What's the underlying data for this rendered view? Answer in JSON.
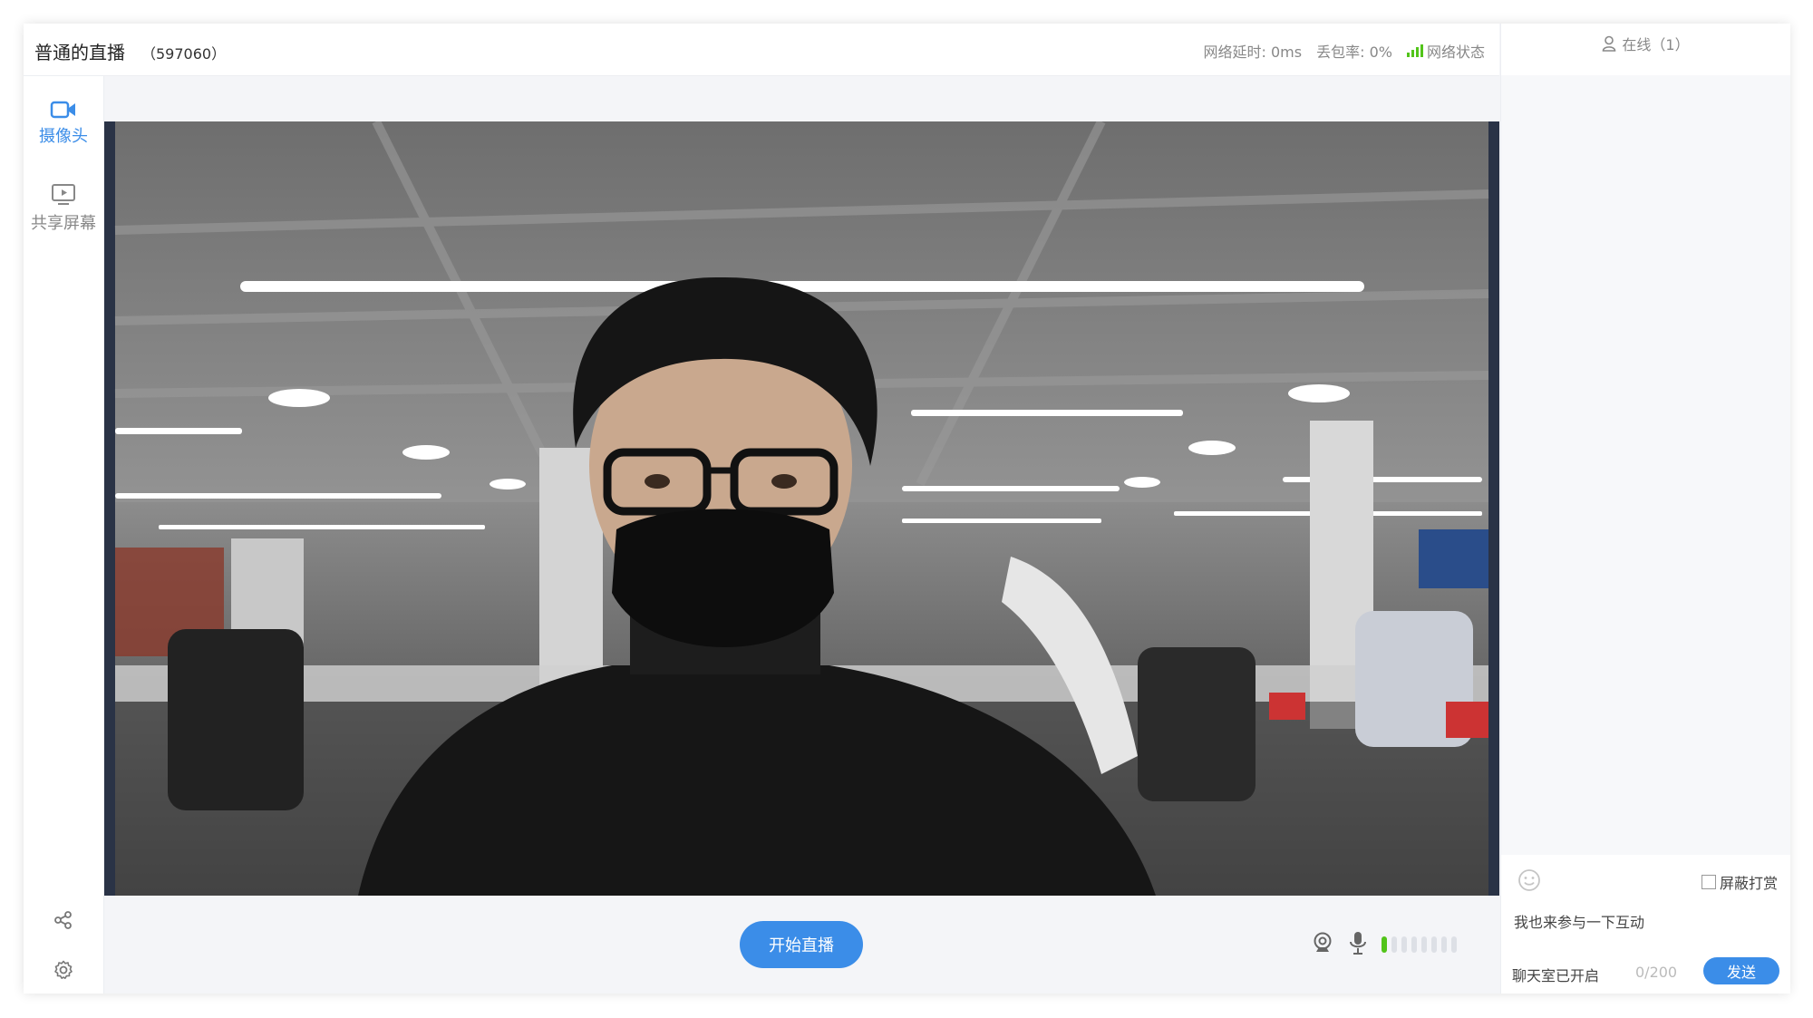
{
  "header": {
    "title": "普通的直播",
    "room_id": "（597060）",
    "latency": "网络延时: 0ms",
    "packet_loss": "丢包率: 0%",
    "network_status": "网络状态"
  },
  "sidebar": {
    "items": [
      {
        "label": "摄像头",
        "icon": "video-camera-icon",
        "active": true
      },
      {
        "label": "共享屏幕",
        "icon": "screen-share-icon",
        "active": false
      }
    ],
    "bottom": [
      {
        "icon": "share-icon"
      },
      {
        "icon": "gear-icon"
      }
    ]
  },
  "main": {
    "start_label": "开始直播",
    "mic_level": 0.125
  },
  "chat": {
    "online_label": "在线（1）",
    "block_gift_label": "屏蔽打赏",
    "input_value": "我也来参与一下互动",
    "status": "聊天室已开启",
    "char_count": "0/200",
    "send_label": "发送"
  },
  "colors": {
    "accent": "#3b8de8",
    "network_good": "#52c41a"
  }
}
